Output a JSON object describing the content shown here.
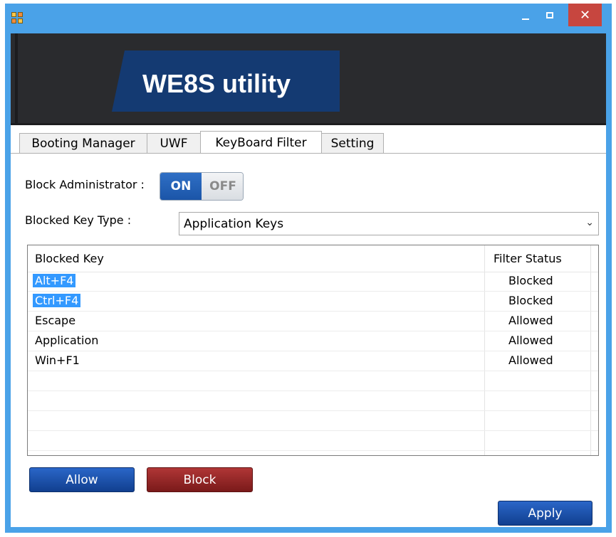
{
  "window": {
    "close_glyph": "✕",
    "title_color": "#4aa2e8"
  },
  "banner": {
    "title": "WE8S utility"
  },
  "tabs": [
    {
      "label": "Booting Manager"
    },
    {
      "label": "UWF"
    },
    {
      "label": "KeyBoard Filter",
      "active": true
    },
    {
      "label": "Setting"
    }
  ],
  "panel": {
    "block_admin_label": "Block Administrator :",
    "toggle": {
      "on_label": "ON",
      "off_label": "OFF",
      "state": "ON"
    },
    "blocked_key_type_label": "Blocked Key Type :",
    "key_type_select": {
      "value": "Application Keys",
      "icon": "chevron-down-icon"
    },
    "table": {
      "columns": [
        "Blocked Key",
        "Filter Status"
      ],
      "rows": [
        {
          "key": "Alt+F4",
          "status": "Blocked",
          "selected": true
        },
        {
          "key": "Ctrl+F4",
          "status": "Blocked",
          "selected": true
        },
        {
          "key": "Escape",
          "status": "Allowed",
          "selected": false
        },
        {
          "key": "Application",
          "status": "Allowed",
          "selected": false
        },
        {
          "key": "Win+F1",
          "status": "Allowed",
          "selected": false
        }
      ]
    },
    "buttons": {
      "allow": "Allow",
      "block": "Block",
      "apply": "Apply"
    }
  }
}
